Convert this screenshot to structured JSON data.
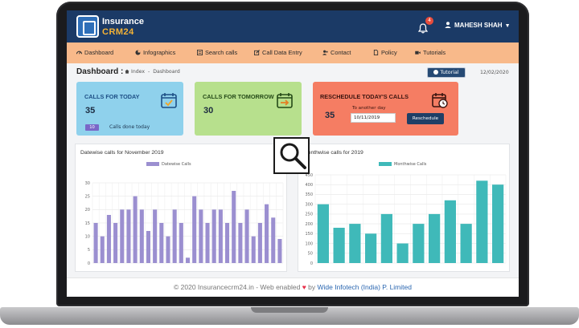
{
  "header": {
    "logo_line1": "Insurance",
    "logo_line2": "CRM24",
    "notification_count": "4",
    "user_name": "MAHESH SHAH"
  },
  "nav": {
    "items": [
      {
        "label": "Dashboard",
        "icon": "dashboard-icon"
      },
      {
        "label": "Infographics",
        "icon": "pie-chart-icon"
      },
      {
        "label": "Search calls",
        "icon": "search-icon"
      },
      {
        "label": "Call Data Entry",
        "icon": "edit-icon"
      },
      {
        "label": "Contact",
        "icon": "contact-icon"
      },
      {
        "label": "Policy",
        "icon": "document-icon"
      },
      {
        "label": "Tutorials",
        "icon": "video-icon"
      }
    ]
  },
  "page": {
    "title": "Dashboard :",
    "crumb_index": "Index",
    "crumb_sep": "-",
    "crumb_current": "Dashboard",
    "tutorial_label": "Tutorial",
    "date": "12/02/2020"
  },
  "cards": {
    "today": {
      "title": "CALLS FOR TODAY",
      "count": "35",
      "done_count": "10",
      "done_label": "Calls done today",
      "color": "#8fd1ec"
    },
    "tomorrow": {
      "title": "CALLS FOR TOMORROW",
      "count": "30",
      "color": "#b7e08d"
    },
    "reschedule": {
      "title": "RESCHEDULE TODAY'S CALLS",
      "count": "35",
      "another_day_label": "To another day",
      "date_value": "10/11/2019",
      "button_label": "Reschedule",
      "color": "#f57d63"
    }
  },
  "chart_data": [
    {
      "type": "bar",
      "title": "Datewise calls for November 2019",
      "series": [
        {
          "name": "Datewise Calls",
          "color": "#9b8fd0",
          "values": [
            15,
            10,
            18,
            15,
            20,
            20,
            25,
            20,
            12,
            20,
            15,
            10,
            20,
            15,
            2,
            25,
            20,
            15,
            20,
            20,
            15,
            27,
            15,
            20,
            10,
            15,
            22,
            17,
            9
          ]
        }
      ],
      "categories": [
        "1",
        "2",
        "3",
        "4",
        "5",
        "6",
        "7",
        "8",
        "9",
        "10",
        "11",
        "12",
        "13",
        "14",
        "15",
        "16",
        "17",
        "18",
        "19",
        "20",
        "21",
        "22",
        "23",
        "24",
        "25",
        "26",
        "27",
        "28",
        "29"
      ],
      "ylim": [
        0,
        30
      ],
      "yticks": [
        "0",
        "5",
        "10",
        "15",
        "20",
        "25",
        "30"
      ],
      "grid": true,
      "legend": "top-center"
    },
    {
      "type": "bar",
      "title": "Monthwise calls for 2019",
      "series": [
        {
          "name": "Monthwise Calls",
          "color": "#3fb9b9",
          "values": [
            300,
            180,
            200,
            150,
            250,
            100,
            200,
            250,
            320,
            200,
            420,
            400
          ]
        }
      ],
      "categories": [
        "Jan",
        "Feb",
        "Mar",
        "Apr",
        "May",
        "Jun",
        "Jul",
        "Aug",
        "Sep",
        "Oct",
        "Nov",
        "Dec"
      ],
      "ylim": [
        0,
        450
      ],
      "yticks": [
        "0",
        "50",
        "100",
        "150",
        "200",
        "250",
        "300",
        "350",
        "400",
        "450"
      ],
      "grid": true,
      "legend": "top-center"
    }
  ],
  "footer": {
    "text_before": "© 2020 Insurancecrm24.in - Web enabled",
    "heart": "♥",
    "by": "by",
    "company": "Wide Infotech (India) P. Limited"
  }
}
